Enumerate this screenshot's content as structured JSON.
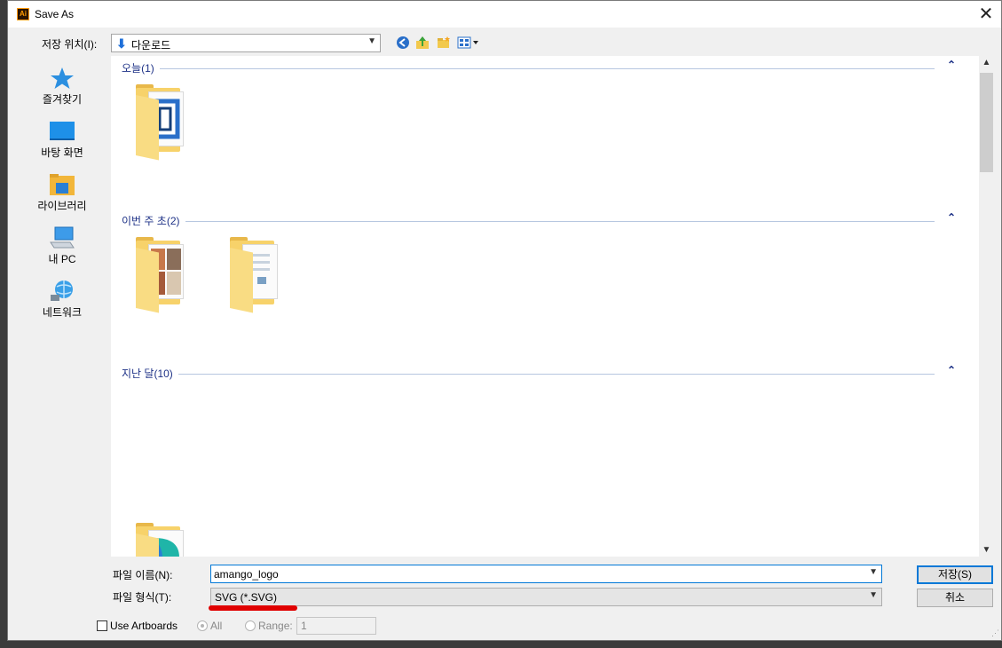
{
  "window": {
    "title": "Save As",
    "app_icon_text": "Ai",
    "close_label": "✕"
  },
  "location": {
    "label": "저장 위치(I):",
    "value": "다운로드"
  },
  "toolbar": {
    "back": "back-icon",
    "up": "up-folder-icon",
    "new_folder": "new-folder-icon",
    "views": "view-menu-icon"
  },
  "nav_pane": {
    "items": [
      {
        "label": "즐겨찾기",
        "icon": "star-icon"
      },
      {
        "label": "바탕 화면",
        "icon": "desktop-icon"
      },
      {
        "label": "라이브러리",
        "icon": "library-icon"
      },
      {
        "label": "내 PC",
        "icon": "computer-icon"
      },
      {
        "label": "네트워크",
        "icon": "network-icon"
      }
    ]
  },
  "groups": [
    {
      "title": "오늘(1)"
    },
    {
      "title": "이번 주 초(2)"
    },
    {
      "title": "지난 달(10)"
    }
  ],
  "file_name": {
    "label": "파일 이름(N):",
    "value": "amango_logo"
  },
  "file_type": {
    "label": "파일 형식(T):",
    "value": "SVG (*.SVG)"
  },
  "buttons": {
    "save": "저장(S)",
    "cancel": "취소"
  },
  "options": {
    "use_artboards_label": "Use Artboards",
    "use_artboards_checked": false,
    "all_label": "All",
    "range_label": "Range:",
    "range_value": "1"
  },
  "colors": {
    "accent": "#0078d7",
    "group_header": "#1e3287",
    "annotation_underline": "#e00000"
  }
}
